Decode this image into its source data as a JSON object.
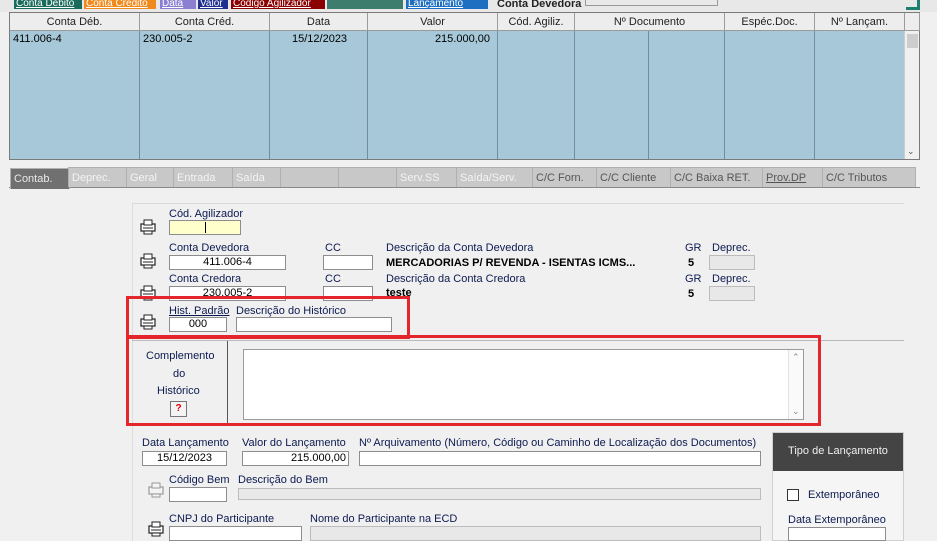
{
  "sort_bar": {
    "items": [
      {
        "label": "Conta Débito",
        "color": "#1b6b5c"
      },
      {
        "label": "Conta Credito",
        "color": "#f08a1c"
      },
      {
        "label": "Data",
        "color": "#8a7fd0"
      },
      {
        "label": "Valor",
        "color": "#1f2f8f"
      },
      {
        "label": "Codigo Agilizador",
        "color": "#8b0000"
      },
      {
        "label": "",
        "color": "#3d7d6d"
      },
      {
        "label": "Lançamento",
        "color": "#1e6fc2"
      }
    ],
    "filter_label": "Conta Devedora"
  },
  "grid": {
    "columns": [
      "Conta Déb.",
      "Conta Créd.",
      "Data",
      "Valor",
      "Cód. Agiliz.",
      "Nº Documento",
      "Espéc.Doc.",
      "Nº Lançam."
    ],
    "rows": [
      {
        "conta_deb": "411.006-4",
        "conta_cred": "230.005-2",
        "data": "15/12/2023",
        "valor": "215.000,00"
      }
    ]
  },
  "tabs": [
    {
      "label": "Contab.",
      "state": "active"
    },
    {
      "label": "Deprec.",
      "state": "disabled"
    },
    {
      "label": "Geral",
      "state": "disabled"
    },
    {
      "label": "Entrada",
      "state": "disabled"
    },
    {
      "label": "Saída",
      "state": "disabled"
    },
    {
      "label": "",
      "state": "disabled"
    },
    {
      "label": "",
      "state": "disabled"
    },
    {
      "label": "Serv.SS",
      "state": "disabled"
    },
    {
      "label": "Saída/Serv.",
      "state": "disabled"
    },
    {
      "label": "C/C Forn.",
      "state": "enabled"
    },
    {
      "label": "C/C Cliente",
      "state": "enabled"
    },
    {
      "label": "C/C Baixa RET.",
      "state": "enabled"
    },
    {
      "label": "Prov.DP",
      "state": "underline"
    },
    {
      "label": "C/C Tributos",
      "state": "enabled"
    }
  ],
  "form": {
    "cod_agilizador": {
      "label": "Cód. Agilizador",
      "value": ""
    },
    "conta_devedora": {
      "label": "Conta Devedora",
      "value": "411.006-4",
      "cc_label": "CC",
      "cc_value": "",
      "desc_label": "Descrição da Conta Devedora",
      "desc_value": "MERCADORIAS P/ REVENDA - ISENTAS ICMS...",
      "gr_label": "GR",
      "gr_value": "5",
      "deprec_label": "Deprec.",
      "deprec_value": ""
    },
    "conta_credora": {
      "label": "Conta Credora",
      "value": "230.005-2",
      "cc_label": "CC",
      "cc_value": "",
      "desc_label": "Descrição da Conta Credora",
      "desc_value": "teste",
      "gr_label": "GR",
      "gr_value": "5",
      "deprec_label": "Deprec.",
      "deprec_value": ""
    },
    "hist_padrao": {
      "label": "Hist. Padrão",
      "value": "000",
      "desc_label": "Descrição do Histórico",
      "desc_value": ""
    },
    "complemento": {
      "line1": "Complemento",
      "line2": "do",
      "line3": "Histórico",
      "help": "?",
      "value": ""
    },
    "data_lancamento": {
      "label": "Data Lançamento",
      "value": "15/12/2023"
    },
    "valor_lancamento": {
      "label": "Valor do Lançamento",
      "value": "215.000,00"
    },
    "arquivamento": {
      "label": "Nº Arquivamento (Número, Código ou Caminho de Localização dos Documentos)",
      "value": ""
    },
    "codigo_bem": {
      "label": "Código Bem",
      "value": ""
    },
    "descricao_bem": {
      "label": "Descrição do Bem",
      "value": ""
    },
    "cnpj_participante": {
      "label": "CNPJ do Participante",
      "value": ""
    },
    "nome_participante": {
      "label": "Nome do Participante na ECD",
      "value": ""
    }
  },
  "tipo_lancamento": {
    "title": "Tipo de Lançamento",
    "extemporaneo_label": "Extemporâneo",
    "extemporaneo_checked": false,
    "data_extemporaneo_label": "Data Extemporâneo",
    "data_extemporaneo_value": ""
  },
  "colors": {
    "grid_background": "#a6c8d8",
    "highlight": "#e4252b",
    "label_text": "#0c1a50"
  }
}
